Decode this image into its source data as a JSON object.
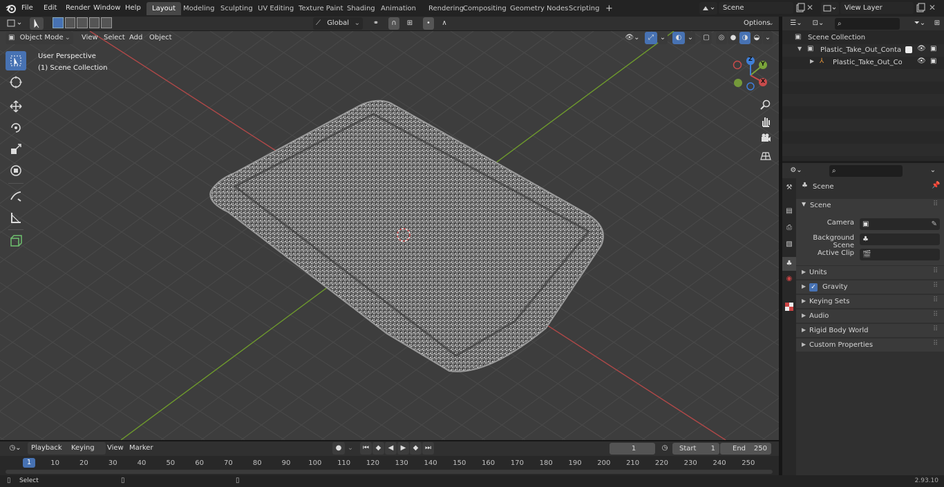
{
  "menus": [
    "File",
    "Edit",
    "Render",
    "Window",
    "Help"
  ],
  "workspaces": [
    "Layout",
    "Modeling",
    "Sculpting",
    "UV Editing",
    "Texture Paint",
    "Shading",
    "Animation",
    "Rendering",
    "Compositing",
    "Geometry Nodes",
    "Scripting"
  ],
  "active_workspace": "Layout",
  "scene_field": "Scene",
  "view_layer_field": "View Layer",
  "header3d": {
    "mode": "Object Mode",
    "menus": [
      "View",
      "Select",
      "Add",
      "Object"
    ],
    "transform_orientation": "Global",
    "options_label": "Options"
  },
  "viewport": {
    "perspective_label": "User Perspective",
    "collection_label": "(1) Scene Collection",
    "gizmo_axes": {
      "x": "X",
      "y": "Y",
      "z": "Z"
    }
  },
  "outliner": {
    "root": "Scene Collection",
    "items": [
      "Plastic_Take_Out_Container_v",
      "Plastic_Take_Out_Contai"
    ]
  },
  "properties": {
    "context": "Scene",
    "panel": "Scene",
    "fields": [
      {
        "label": "Camera",
        "value": ""
      },
      {
        "label": "Background Scene",
        "value": ""
      },
      {
        "label": "Active Clip",
        "value": ""
      }
    ],
    "subpanels": [
      "Units",
      "Gravity",
      "Keying Sets",
      "Audio",
      "Rigid Body World",
      "Custom Properties"
    ],
    "gravity_checked": true
  },
  "timeline": {
    "menus": [
      "Playback",
      "Keying",
      "View",
      "Marker"
    ],
    "current_frame": "1",
    "start_label": "Start",
    "start_value": "1",
    "end_label": "End",
    "end_value": "250",
    "ticks": [
      "1",
      "10",
      "20",
      "30",
      "40",
      "50",
      "60",
      "70",
      "80",
      "90",
      "100",
      "110",
      "120",
      "130",
      "140",
      "150",
      "160",
      "170",
      "180",
      "190",
      "200",
      "210",
      "220",
      "230",
      "240",
      "250"
    ]
  },
  "status": {
    "left": "Select",
    "version": "2.93.10"
  },
  "colors": {
    "accent": "#4772b3",
    "x_axis": "#c84b4b",
    "y_axis": "#7aa33a",
    "z_axis": "#3f7fd8"
  }
}
